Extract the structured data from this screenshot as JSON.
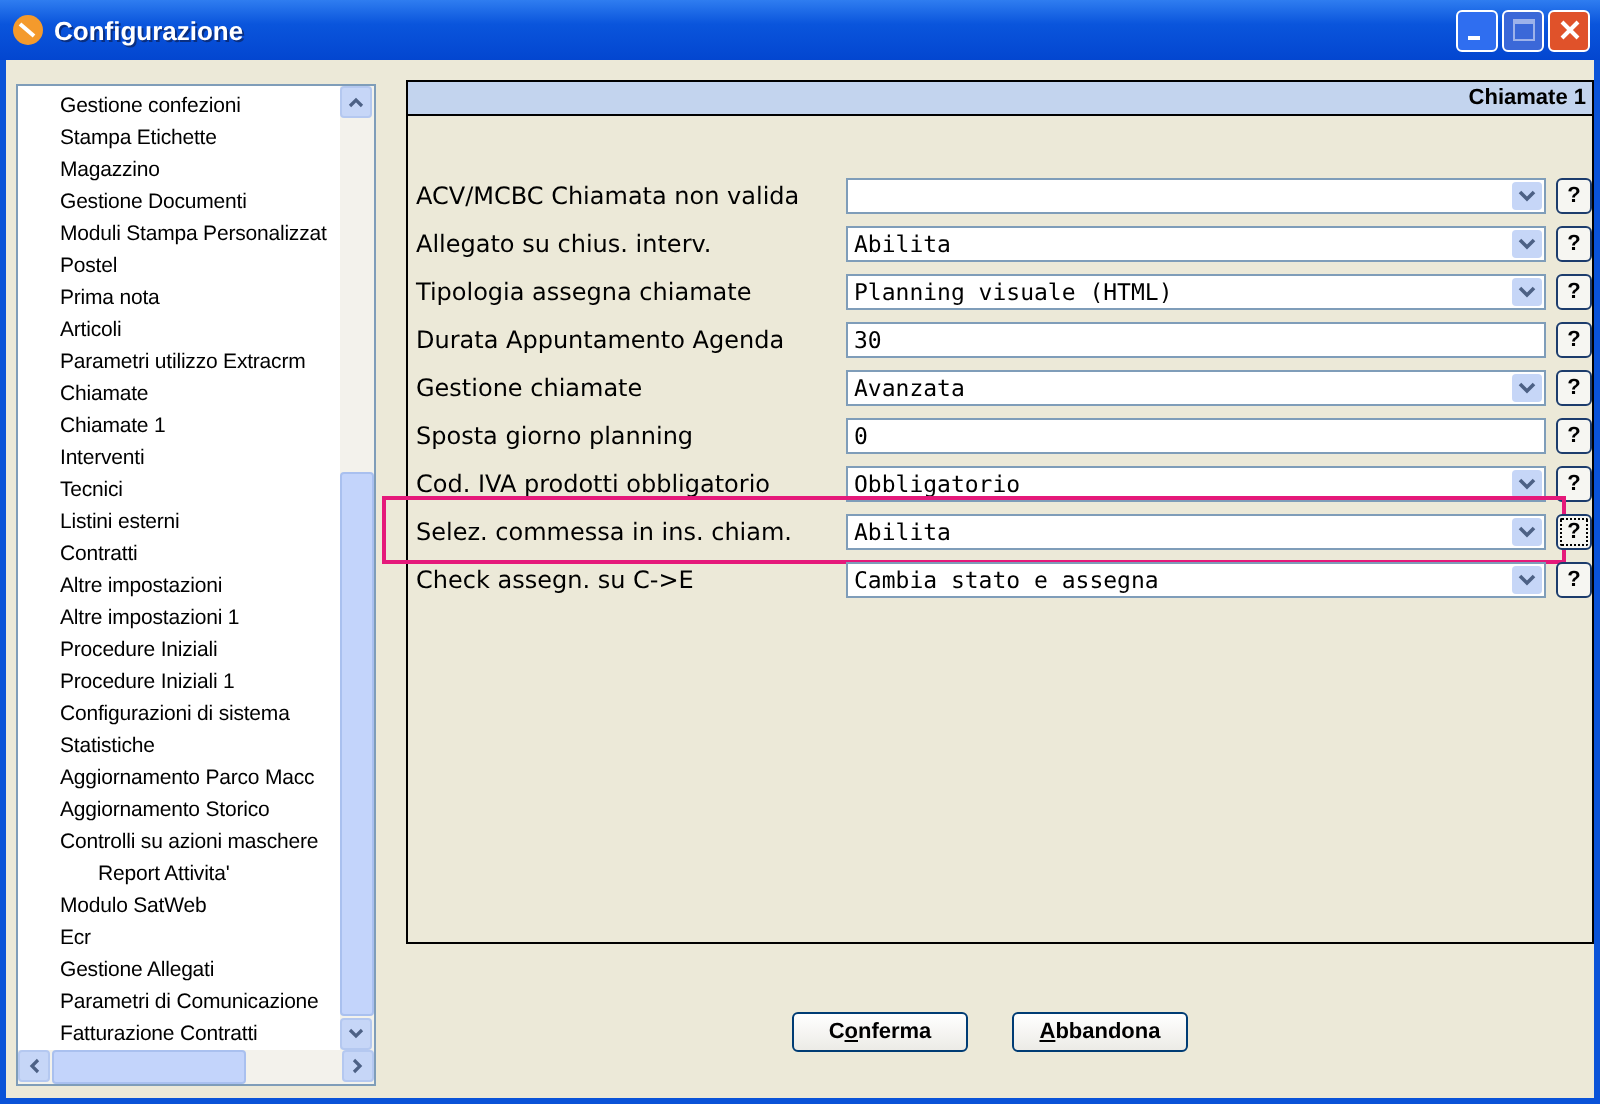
{
  "window": {
    "title": "Configurazione"
  },
  "sidebar": {
    "items": [
      {
        "label": "Gestione confezioni"
      },
      {
        "label": "Stampa Etichette"
      },
      {
        "label": "Magazzino"
      },
      {
        "label": "Gestione Documenti"
      },
      {
        "label": "Moduli Stampa Personalizzat"
      },
      {
        "label": "Postel"
      },
      {
        "label": "Prima nota"
      },
      {
        "label": "Articoli"
      },
      {
        "label": "Parametri utilizzo Extracrm"
      },
      {
        "label": "Chiamate"
      },
      {
        "label": "Chiamate 1"
      },
      {
        "label": "Interventi"
      },
      {
        "label": "Tecnici"
      },
      {
        "label": "Listini esterni"
      },
      {
        "label": "Contratti"
      },
      {
        "label": "Altre impostazioni"
      },
      {
        "label": "Altre impostazioni 1"
      },
      {
        "label": "Procedure Iniziali"
      },
      {
        "label": "Procedure Iniziali 1"
      },
      {
        "label": "Configurazioni di sistema"
      },
      {
        "label": "Statistiche"
      },
      {
        "label": "Aggiornamento Parco Macc"
      },
      {
        "label": "Aggiornamento Storico"
      },
      {
        "label": "Controlli su azioni maschere",
        "children": [
          {
            "label": "Report Attivita'"
          }
        ]
      },
      {
        "label": "Modulo SatWeb"
      },
      {
        "label": "Ecr"
      },
      {
        "label": "Gestione Allegati"
      },
      {
        "label": "Parametri di Comunicazione"
      },
      {
        "label": "Fatturazione Contratti"
      }
    ]
  },
  "panel": {
    "title": "Chiamate 1",
    "rows": [
      {
        "label": "ACV/MCBC Chiamata non valida",
        "kind": "select",
        "highlighted": false,
        "help": "?"
      },
      {
        "label": "Allegato su chius. interv.",
        "kind": "select",
        "value": "Abilita",
        "highlighted": false,
        "help": "?"
      },
      {
        "label": "Tipologia assegna chiamate",
        "kind": "select",
        "value": "Planning visuale (HTML)",
        "highlighted": false,
        "help": "?"
      },
      {
        "label": "Durata Appuntamento Agenda",
        "kind": "text",
        "value": "30",
        "highlighted": false,
        "help": "?"
      },
      {
        "label": "Gestione chiamate",
        "kind": "select",
        "value": "Avanzata",
        "highlighted": false,
        "help": "?"
      },
      {
        "label": "Sposta giorno planning",
        "kind": "text",
        "value": "0",
        "highlighted": false,
        "help": "?"
      },
      {
        "label": "Cod. IVA prodotti obbligatorio",
        "kind": "select",
        "value": "Obbligatorio",
        "highlighted": false,
        "help": "?"
      },
      {
        "label": "Selez. commessa in ins. chiam.",
        "kind": "select",
        "value": "Abilita",
        "highlighted": true,
        "help": "?"
      },
      {
        "label": "Check assegn. su C->E",
        "kind": "select",
        "value": "Cambia stato e assegna",
        "highlighted": false,
        "help": "?"
      }
    ]
  },
  "buttons": [
    {
      "before": "C",
      "key": "o",
      "after": "nferma"
    },
    {
      "key": "A",
      "after": "bbandona"
    }
  ]
}
